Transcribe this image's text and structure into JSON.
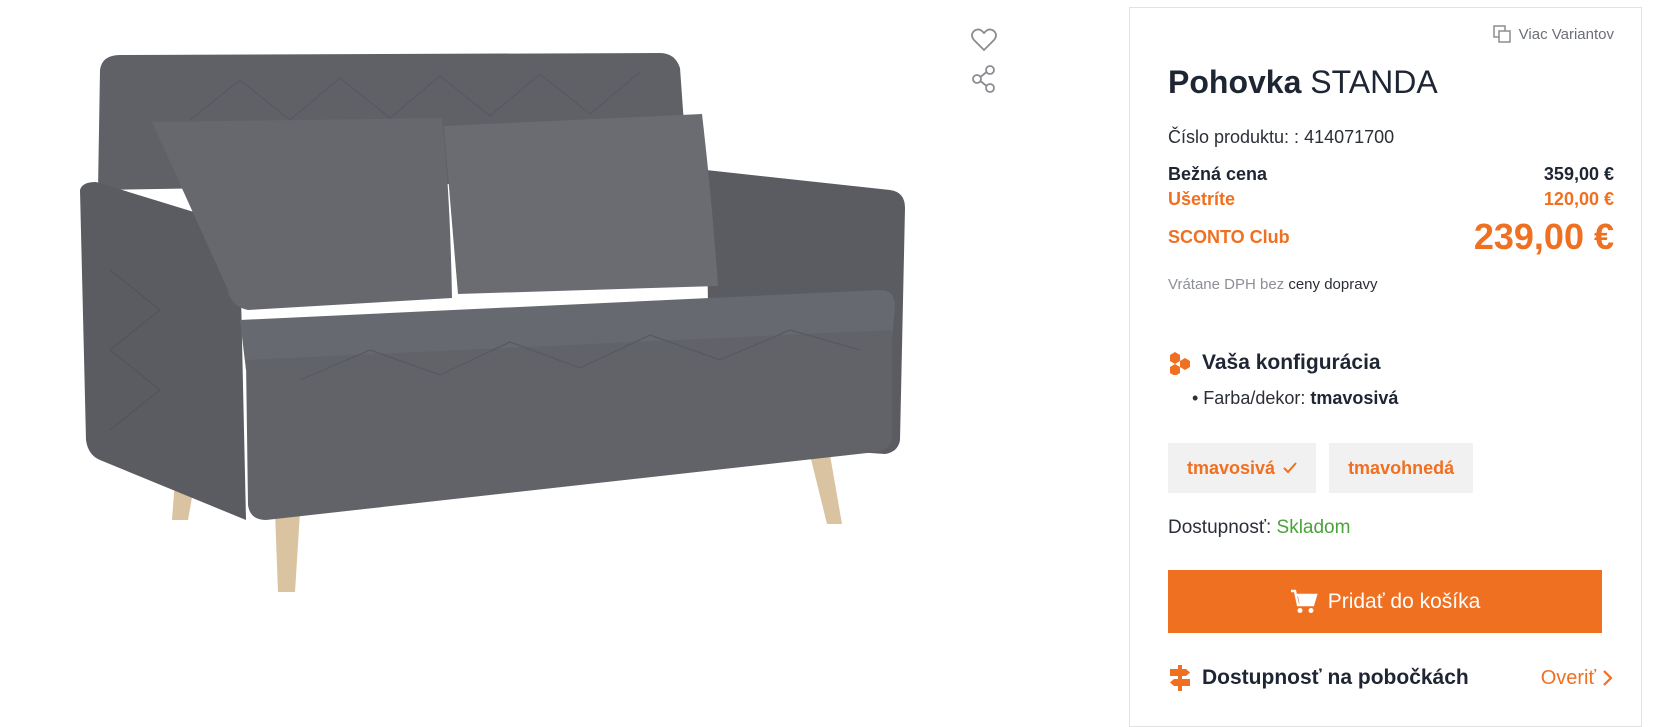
{
  "product": {
    "title_bold": "Pohovka",
    "title_model": "STANDA",
    "number_label": "Číslo produktu: :",
    "number_value": "414071700",
    "variants_link": "Viac Variantov"
  },
  "pricing": {
    "regular_label": "Bežná cena",
    "regular_value": "359,00 €",
    "save_label": "Ušetríte",
    "save_value": "120,00 €",
    "club_label": "SCONTO Club",
    "club_value": "239,00 €",
    "vat_text": "Vrátane DPH bez",
    "vat_link": "ceny dopravy"
  },
  "configuration": {
    "heading": "Vaša konfigurácia",
    "item_label": "• Farba/dekor:",
    "item_value": "tmavosivá",
    "options": [
      {
        "label": "tmavosivá",
        "selected": true
      },
      {
        "label": "tmavohnedá",
        "selected": false
      }
    ]
  },
  "availability": {
    "label": "Dostupnosť:",
    "value": "Skladom"
  },
  "cart_button": "Pridať do košíka",
  "stores": {
    "label": "Dostupnosť na pobočkách",
    "link": "Overiť"
  },
  "colors": {
    "accent": "#f07021",
    "in_stock": "#4aa33a",
    "text_dark": "#1f2633"
  },
  "icons": [
    "heart-icon",
    "share-icon",
    "copy-icon",
    "config-icon",
    "cart-icon",
    "signpost-icon",
    "chevron-right-icon"
  ]
}
